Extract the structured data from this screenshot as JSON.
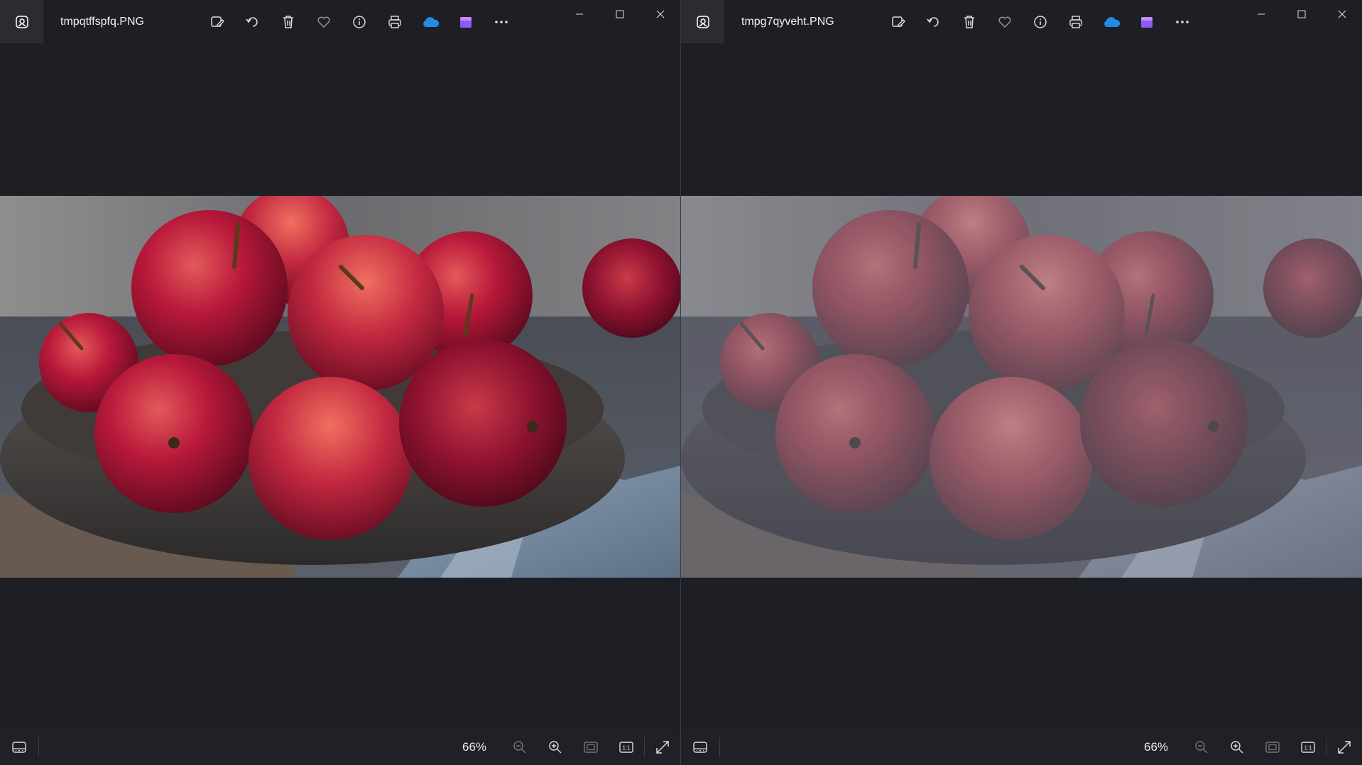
{
  "windows": [
    {
      "filename": "tmpqtffspfq.PNG",
      "zoom": "66%",
      "desaturated": false
    },
    {
      "filename": "tmpg7qyveht.PNG",
      "zoom": "66%",
      "desaturated": true
    }
  ],
  "toolbar_icons": [
    "edit-image-icon",
    "rotate-icon",
    "delete-icon",
    "favorite-icon",
    "info-icon",
    "print-icon",
    "onedrive-icon",
    "clipchamp-icon",
    "more-icon"
  ],
  "bottom_icons": [
    "filmstrip-icon",
    "zoom-out-icon",
    "zoom-in-icon",
    "fit-to-window-icon",
    "actual-size-icon",
    "fullscreen-icon"
  ],
  "colors": {
    "background": "#1e1f25",
    "accent_cloud": "#1f8ce6",
    "accent_clip": "#8a5cf0"
  },
  "image": {
    "subject": "red apples in a dark ceramic bowl on a blue cloth"
  }
}
